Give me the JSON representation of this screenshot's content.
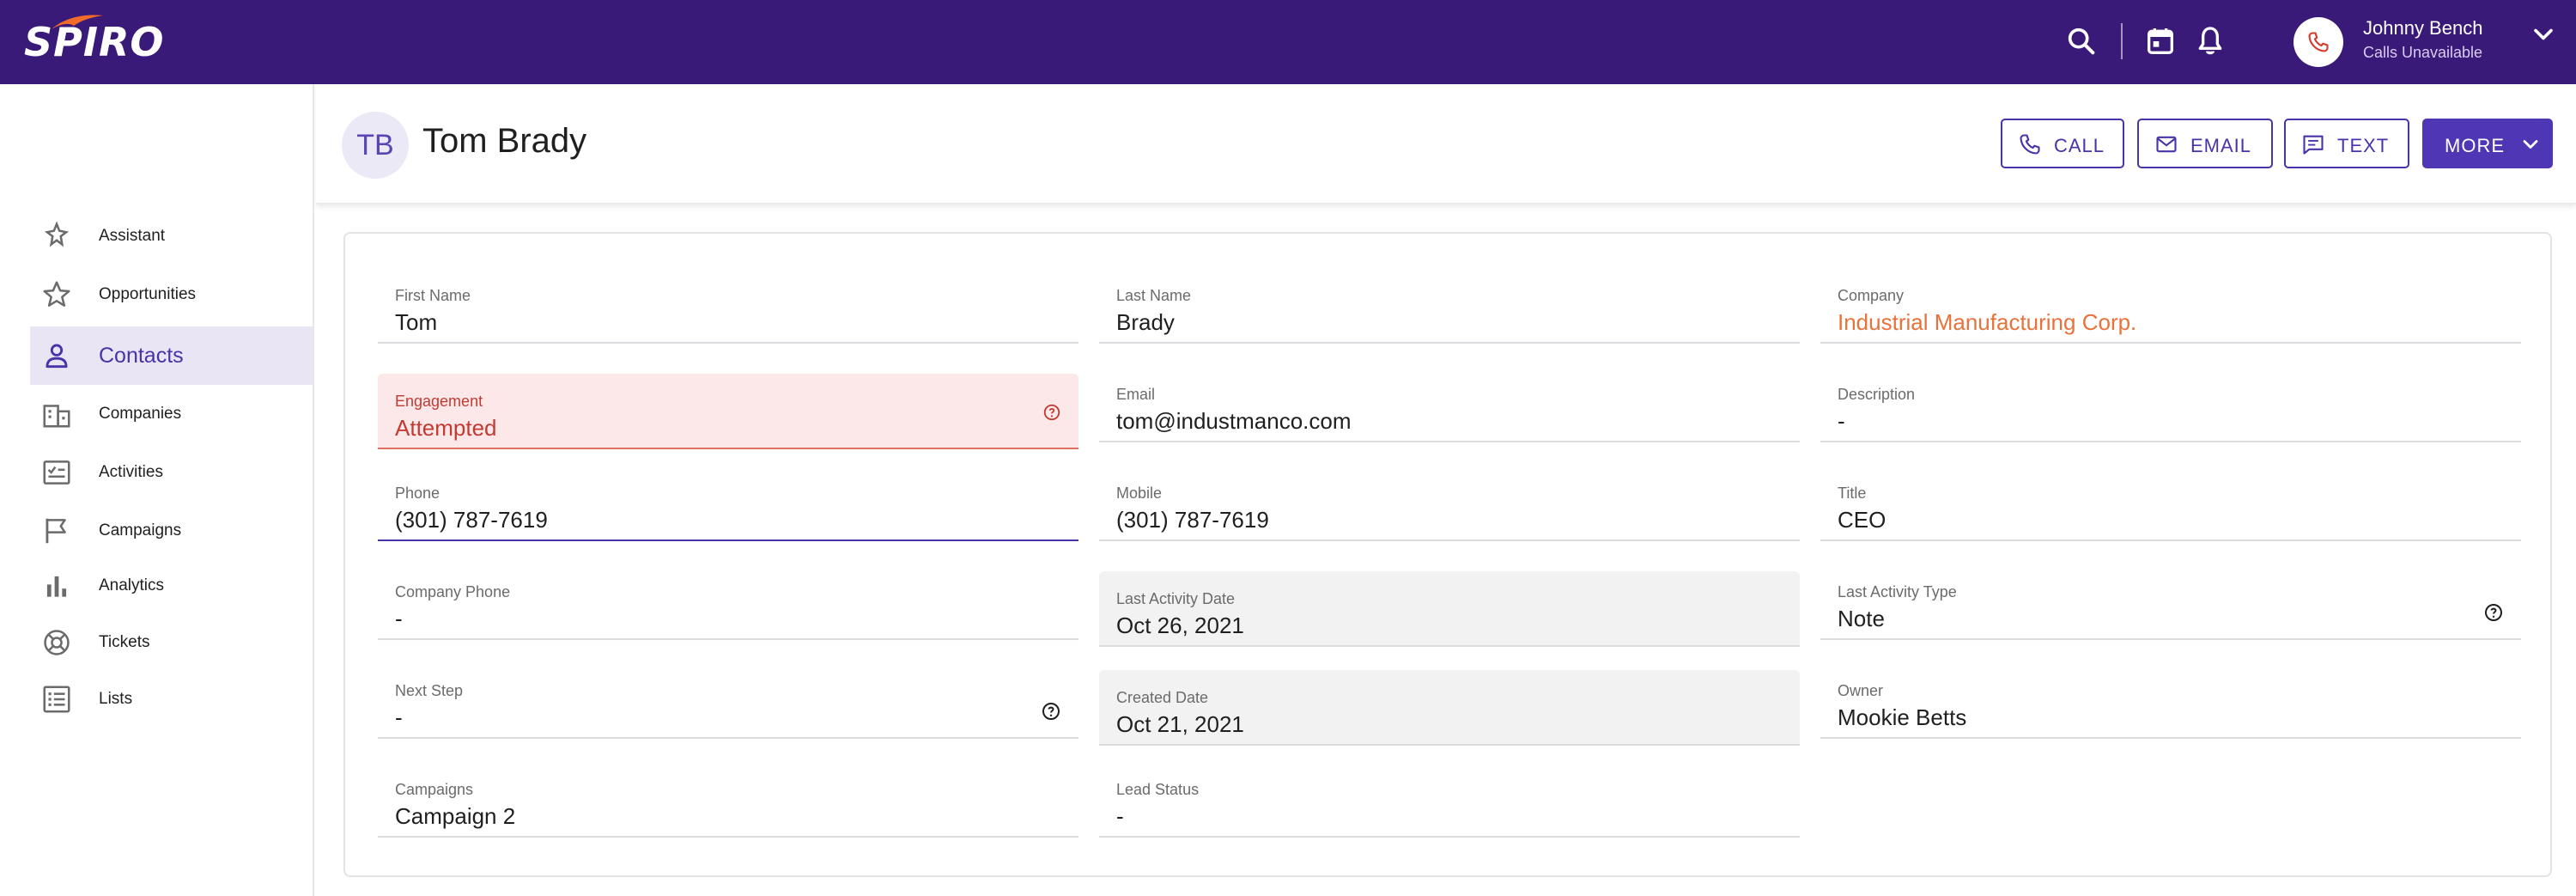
{
  "app": {
    "logo_text": "SPIRO"
  },
  "topbar": {
    "search_icon": "search-icon",
    "calendar_icon": "calendar-icon",
    "bell_icon": "bell-icon",
    "user_name": "Johnny Bench",
    "user_status": "Calls Unavailable",
    "accent": "#3a1a78",
    "phone_icon_color": "#d93a2b"
  },
  "sidebar": {
    "items": [
      {
        "label": "Assistant",
        "icon": "assistant-icon",
        "active": false
      },
      {
        "label": "Opportunities",
        "icon": "star-icon",
        "active": false
      },
      {
        "label": "Contacts",
        "icon": "person-icon",
        "active": true
      },
      {
        "label": "Companies",
        "icon": "building-icon",
        "active": false
      },
      {
        "label": "Activities",
        "icon": "checklist-icon",
        "active": false
      },
      {
        "label": "Campaigns",
        "icon": "flag-icon",
        "active": false
      },
      {
        "label": "Analytics",
        "icon": "bar-chart-icon",
        "active": false
      },
      {
        "label": "Tickets",
        "icon": "lifebuoy-icon",
        "active": false
      },
      {
        "label": "Lists",
        "icon": "list-icon",
        "active": false
      }
    ]
  },
  "header": {
    "initials": "TB",
    "name": "Tom Brady",
    "buttons": {
      "call": "CALL",
      "email": "EMAIL",
      "text": "TEXT",
      "more": "MORE"
    }
  },
  "fields": {
    "first_name": {
      "label": "First Name",
      "value": "Tom"
    },
    "last_name": {
      "label": "Last Name",
      "value": "Brady"
    },
    "company": {
      "label": "Company",
      "value": "Industrial Manufacturing Corp."
    },
    "engagement": {
      "label": "Engagement",
      "value": "Attempted"
    },
    "email": {
      "label": "Email",
      "value": "tom@industmanco.com"
    },
    "description": {
      "label": "Description",
      "value": "-"
    },
    "phone": {
      "label": "Phone",
      "value": "(301) 787-7619"
    },
    "mobile": {
      "label": "Mobile",
      "value": "(301) 787-7619"
    },
    "title": {
      "label": "Title",
      "value": "CEO"
    },
    "company_phone": {
      "label": "Company Phone",
      "value": "-"
    },
    "last_activity_date": {
      "label": "Last Activity Date",
      "value": "Oct 26, 2021"
    },
    "last_activity_type": {
      "label": "Last Activity Type",
      "value": "Note"
    },
    "next_step": {
      "label": "Next Step",
      "value": "-"
    },
    "created_date": {
      "label": "Created Date",
      "value": "Oct 21, 2021"
    },
    "owner": {
      "label": "Owner",
      "value": "Mookie Betts"
    },
    "campaigns": {
      "label": "Campaigns",
      "value": "Campaign 2"
    },
    "lead_status": {
      "label": "Lead Status",
      "value": "-"
    }
  },
  "colors": {
    "primary": "#4a32a8",
    "error": "#c23b32",
    "link": "#e8723c"
  }
}
